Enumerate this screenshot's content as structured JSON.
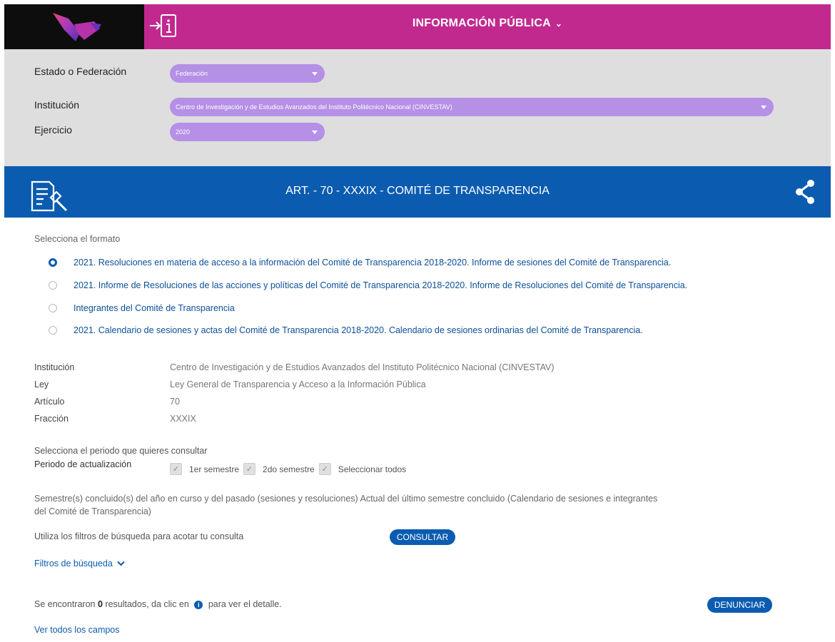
{
  "header": {
    "title": "INFORMACIÓN PÚBLICA",
    "chevron": "⌄"
  },
  "filters": {
    "estado_label": "Estado o Federación",
    "estado_value": "Federación",
    "institucion_label": "Institución",
    "institucion_value": "Centro de Investigación y de Estudios Avanzados del Instituto Politécnico Nacional (CINVESTAV)",
    "ejercicio_label": "Ejercicio",
    "ejercicio_value": "2020"
  },
  "banner": {
    "title": "ART. - 70 - XXXIX - COMITÉ DE TRANSPARENCIA"
  },
  "formato": {
    "heading": "Selecciona el formato",
    "options": [
      {
        "label": "2021. Resoluciones en materia de acceso a la información del Comité de Transparencia 2018-2020. Informe de sesiones del Comité de Transparencia.",
        "selected": true
      },
      {
        "label": "2021. Informe de Resoluciones de las acciones y políticas del Comité de Transparencia 2018-2020. Informe de Resoluciones del Comité de Transparencia.",
        "selected": false
      },
      {
        "label": "Integrantes del Comité de Transparencia",
        "selected": false
      },
      {
        "label": "2021. Calendario de sesiones y actas del Comité de Transparencia 2018-2020. Calendario de sesiones ordinarias del Comité de Transparencia.",
        "selected": false
      }
    ]
  },
  "details": {
    "institucion_key": "Institución",
    "institucion_val": "Centro de Investigación y de Estudios Avanzados del Instituto Politécnico Nacional (CINVESTAV)",
    "ley_key": "Ley",
    "ley_val": "Ley General de Transparencia y Acceso a la Información Pública",
    "articulo_key": "Artículo",
    "articulo_val": "70",
    "fraccion_key": "Fracción",
    "fraccion_val": "XXXIX"
  },
  "periodo": {
    "heading": "Selecciona el periodo que quieres consultar",
    "label": "Periodo de actualización",
    "options": [
      "1er semestre",
      "2do semestre",
      "Seleccionar todos"
    ],
    "description_line1": "Semestre(s) concluido(s) del año en curso y del pasado (sesiones y resoluciones) Actual del último semestre concluido (Calendario de sesiones e integrantes",
    "description_line2": "del Comité de Transparencia)"
  },
  "search": {
    "hint": "Utiliza los filtros de búsqueda para acotar tu consulta",
    "consultar": "CONSULTAR",
    "filtros_link": "Filtros de búsqueda"
  },
  "results": {
    "prefix": "Se encontraron",
    "count": "0",
    "middle": "resultados, da clic en",
    "suffix": "para ver el detalle.",
    "info_glyph": "i",
    "denunciar": "DENUNCIAR",
    "ver_todos": "Ver todos los campos"
  },
  "colors": {
    "pink": "#c2298f",
    "blue": "#0b5cb0",
    "select": "#b590e6",
    "panel": "#dedede"
  },
  "icons": [
    "logo",
    "login-icon",
    "document-gavel-icon",
    "share-icon",
    "info-icon",
    "check-icon",
    "chevron-down-icon"
  ]
}
